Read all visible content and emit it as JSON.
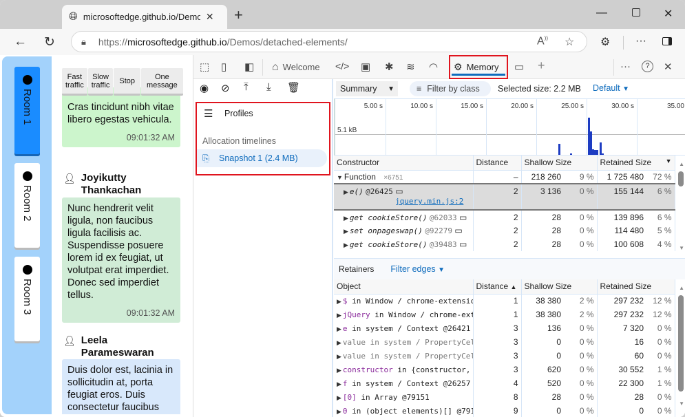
{
  "browser": {
    "tab_title": "microsoftedge.github.io/Demos/d",
    "url_prefix": "https://",
    "url_host": "microsoftedge.github.io",
    "url_path": "/Demos/detached-elements/"
  },
  "app": {
    "rooms": [
      {
        "label": "Room 1",
        "active": true
      },
      {
        "label": "Room 2",
        "active": false
      },
      {
        "label": "Room 3",
        "active": false
      }
    ],
    "buttons": [
      "Fast traffic",
      "Slow traffic",
      "Stop",
      "One message"
    ],
    "buttons_lines": [
      [
        "Fast",
        "traffic"
      ],
      [
        "Slow",
        "traffic"
      ],
      [
        "Stop"
      ],
      [
        "One",
        "message"
      ]
    ],
    "messages": [
      {
        "text": "Cras tincidunt nibh vitae libero egestas vehicula.",
        "time": "09:01:32 AM",
        "color": "#ccf5cc"
      },
      {
        "author": "Joyikutty Thankachan",
        "text": "Nunc hendrerit velit ligula, non faucibus ligula facilisis ac. Suspendisse posuere lorem id ex feugiat, ut volutpat erat imperdiet. Donec sed imperdiet tellus.",
        "time": "09:01:32 AM",
        "color": "#d0ecd6"
      },
      {
        "author": "Leela Parameswaran",
        "text": "Duis dolor est, lacinia in sollicitudin at, porta feugiat eros. Duis consectetur faucibus",
        "color": "#d8e8fb"
      }
    ]
  },
  "devtools": {
    "tabs": {
      "welcome": "Welcome",
      "memory": "Memory"
    },
    "sidebar": {
      "profiles": "Profiles",
      "section": "Allocation timelines",
      "snapshot": "Snapshot 1 (2.4 MB)"
    },
    "toolbar": {
      "view": "Summary",
      "filter_placeholder": "Filter by class",
      "selected_size": "Selected size: 2.2 MB",
      "default": "Default"
    },
    "timeline": {
      "ticks": [
        "5.00 s",
        "10.00 s",
        "15.00 s",
        "20.00 s",
        "25.00 s",
        "30.00 s",
        "35.00"
      ],
      "y_label": "5.1 kB"
    },
    "constructors": {
      "headers": [
        "Constructor",
        "Distance",
        "Shallow Size",
        "Retained Size"
      ],
      "rows": [
        {
          "name": "Function",
          "count": "×6751",
          "distance": "–",
          "shallow": "218 260",
          "shallow_pct": "9 %",
          "retained": "1 725 480",
          "retained_pct": "72 %",
          "expanded": true
        },
        {
          "name": "e()",
          "id": "@26425",
          "link": "jquery.min.js:2",
          "distance": "2",
          "shallow": "3 136",
          "shallow_pct": "0 %",
          "retained": "155 144",
          "retained_pct": "6 %",
          "selected": true
        },
        {
          "name": "get cookieStore()",
          "id": "@62033",
          "distance": "2",
          "shallow": "28",
          "shallow_pct": "0 %",
          "retained": "139 896",
          "retained_pct": "6 %"
        },
        {
          "name": "set onpageswap()",
          "id": "@92279",
          "distance": "2",
          "shallow": "28",
          "shallow_pct": "0 %",
          "retained": "114 480",
          "retained_pct": "5 %"
        },
        {
          "name": "get cookieStore()",
          "id": "@39483",
          "distance": "2",
          "shallow": "28",
          "shallow_pct": "0 %",
          "retained": "100 608",
          "retained_pct": "4 %"
        }
      ]
    },
    "retainers": {
      "title": "Retainers",
      "filter": "Filter edges",
      "headers": [
        "Object",
        "Distance",
        "Shallow Size",
        "Retained Size"
      ],
      "rows": [
        {
          "prop": "$",
          "rest": " in Window / chrome-extensic",
          "distance": "1",
          "shallow": "38 380",
          "shallow_pct": "2 %",
          "retained": "297 232",
          "retained_pct": "12 %",
          "style": "purple"
        },
        {
          "prop": "jQuery",
          "rest": " in Window / chrome-ext",
          "distance": "1",
          "shallow": "38 380",
          "shallow_pct": "2 %",
          "retained": "297 232",
          "retained_pct": "12 %",
          "style": "purple"
        },
        {
          "prop": "e",
          "rest": " in system / Context @26421",
          "distance": "3",
          "shallow": "136",
          "shallow_pct": "0 %",
          "retained": "7 320",
          "retained_pct": "0 %",
          "style": "purple"
        },
        {
          "prop": "value",
          "rest": " in system / PropertyCel",
          "distance": "3",
          "shallow": "0",
          "shallow_pct": "0 %",
          "retained": "16",
          "retained_pct": "0 %",
          "style": "grey"
        },
        {
          "prop": "value",
          "rest": " in system / PropertyCel",
          "distance": "3",
          "shallow": "0",
          "shallow_pct": "0 %",
          "retained": "60",
          "retained_pct": "0 %",
          "style": "grey"
        },
        {
          "prop": "constructor",
          "rest": " in {constructor,",
          "distance": "3",
          "shallow": "620",
          "shallow_pct": "0 %",
          "retained": "30 552",
          "retained_pct": "1 %",
          "style": "purple"
        },
        {
          "prop": "f",
          "rest": " in system / Context @26257",
          "distance": "4",
          "shallow": "520",
          "shallow_pct": "0 %",
          "retained": "22 300",
          "retained_pct": "1 %",
          "style": "purple"
        },
        {
          "prop": "[0]",
          "rest": " in Array @79151",
          "distance": "8",
          "shallow": "28",
          "shallow_pct": "0 %",
          "retained": "28",
          "retained_pct": "0 %",
          "style": "purple"
        },
        {
          "prop": "0",
          "rest": " in (object elements)[] @791",
          "distance": "9",
          "shallow": "0",
          "shallow_pct": "0 %",
          "retained": "0",
          "retained_pct": "0 %",
          "style": "purple"
        }
      ]
    }
  }
}
